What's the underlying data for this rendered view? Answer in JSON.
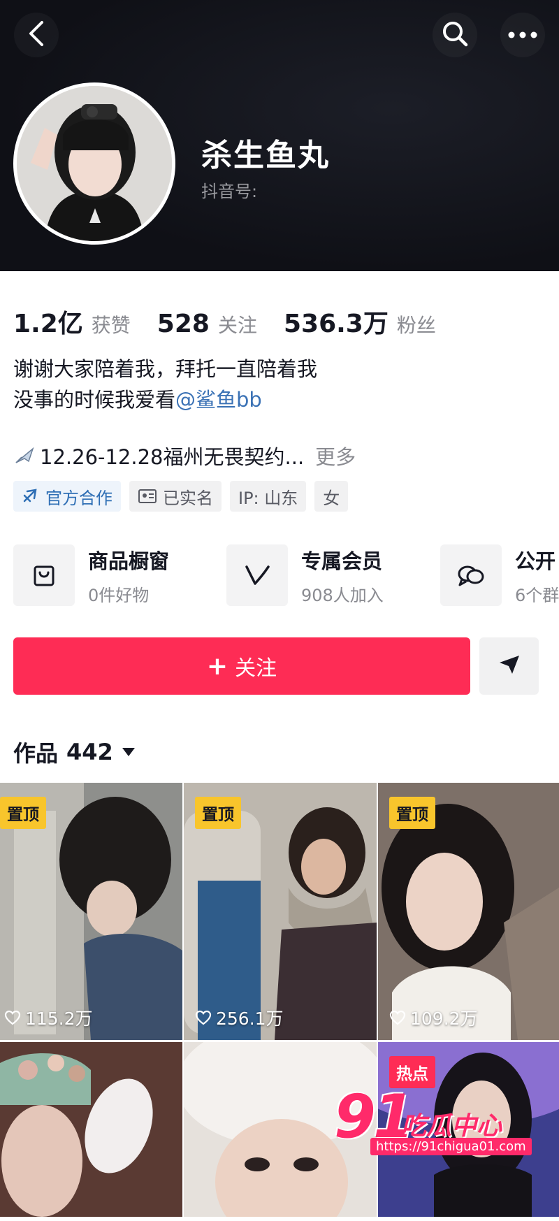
{
  "header": {
    "back_icon": "chevron-left-icon",
    "search_icon": "search-icon",
    "more_icon": "more-dots-icon"
  },
  "profile": {
    "nickname": "杀生鱼丸",
    "douyin_id_label": "抖音号:"
  },
  "stats": [
    {
      "value": "1.2亿",
      "label": "获赞"
    },
    {
      "value": "528",
      "label": "关注"
    },
    {
      "value": "536.3万",
      "label": "粉丝"
    }
  ],
  "bio": {
    "line1": "谢谢大家陪着我，拜托一直陪着我",
    "line2_prefix": "没事的时候我爱看",
    "mention": "@鲨鱼bb"
  },
  "event": {
    "icon": "airplane-icon",
    "text": "12.26-12.28福州无畏契约...",
    "more": "更多"
  },
  "tags": [
    {
      "label": "官方合作",
      "icon": "official-badge-icon"
    },
    {
      "label": "已实名",
      "icon": "id-card-icon"
    },
    {
      "label": "IP:  山东"
    },
    {
      "label": "女"
    }
  ],
  "services": [
    {
      "title": "商品橱窗",
      "subtitle": "0件好物",
      "icon": "shopping-bag-icon"
    },
    {
      "title": "专属会员",
      "subtitle": "908人加入",
      "icon": "v-member-icon"
    },
    {
      "title": "公开",
      "subtitle": "6个群",
      "icon": "group-chat-icon"
    }
  ],
  "actions": {
    "follow_label": "关注",
    "follow_plus": "+",
    "share_icon": "send-arrow-icon"
  },
  "works": {
    "label": "作品",
    "count": "442"
  },
  "grid": [
    {
      "badge": "置顶",
      "likes": "115.2万"
    },
    {
      "badge": "置顶",
      "likes": "256.1万"
    },
    {
      "badge": "置顶",
      "likes": "109.2万"
    },
    {
      "badge": "",
      "likes": ""
    },
    {
      "badge": "",
      "likes": ""
    },
    {
      "badge": "热点",
      "likes": ""
    }
  ],
  "watermark": {
    "number": "91",
    "text": "吃瓜中心",
    "url": "https://91chigua01.com"
  }
}
